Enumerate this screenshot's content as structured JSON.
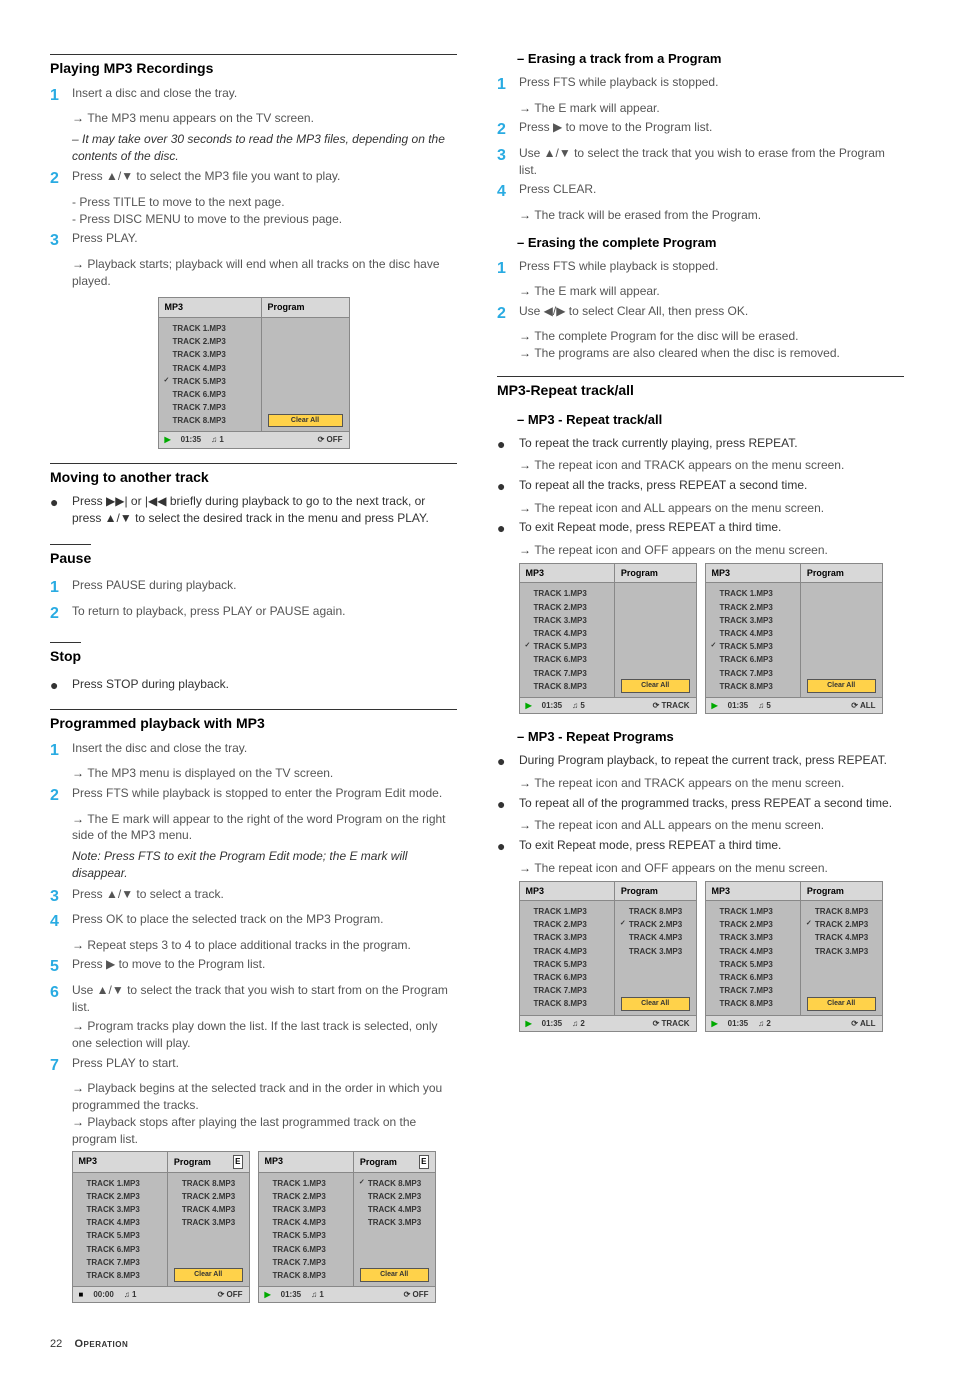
{
  "left": {
    "h_play": "Playing MP3 Recordings",
    "s1": "Insert a disc and close the tray.",
    "s1a": "The MP3 menu appears on the TV screen.",
    "s1note": "– It may take over 30 seconds to read the MP3 files, depending on the contents of the disc.",
    "s2": "Press ▲/▼ to select the MP3 file you want to play.",
    "s2a": "- Press TITLE to move to the next page.",
    "s2b": "- Press DISC MENU to move to the previous page.",
    "s3": "Press PLAY.",
    "s3a": "Playback starts; playback will end when all tracks on the disc have played.",
    "h_move": "Moving to another track",
    "move_b": "Press ▶▶| or |◀◀ briefly during playback to go to the next track, or press ▲/▼ to select the desired track in the menu and press PLAY.",
    "h_pause": "Pause",
    "p1": "Press PAUSE during playback.",
    "p2": "To return to playback, press PLAY or PAUSE again.",
    "h_stop": "Stop",
    "stop_b": "Press STOP during playback.",
    "h_prog": "Programmed playback with MP3",
    "pp1": "Insert the disc and close the tray.",
    "pp1a": "The MP3 menu is displayed on the TV screen.",
    "pp2": "Press FTS while playback is stopped to enter the Program Edit mode.",
    "pp2a": "The E mark will appear to the right of the word Program on the right side of the MP3 menu.",
    "pp2note": "Note: Press FTS to exit the Program Edit mode;  the E mark will disappear.",
    "pp3": "Press ▲/▼ to select a track.",
    "pp4": "Press OK to place the selected track on the MP3 Program.",
    "pp4a": "Repeat steps 3 to 4 to place additional tracks in the program.",
    "pp5": "Press ▶ to move to the Program list.",
    "pp6": "Use ▲/▼ to select the track that you wish to start from on the Program list.",
    "pp6a": "Program tracks play down the list. If the last track is selected, only one selection will play.",
    "pp7": "Press PLAY to start.",
    "pp7a": "Playback begins at the selected track and in the order in which you programmed the tracks.",
    "pp7b": "Playback stops after playing the last programmed track on the program list."
  },
  "right": {
    "h_erase": "– Erasing a track from a Program",
    "e1": "Press FTS while playback is stopped.",
    "e1a": "The E mark will appear.",
    "e2": "Press ▶ to move to the Program list.",
    "e3": "Use ▲/▼ to select the track that you wish to erase from the Program list.",
    "e4": "Press CLEAR.",
    "e4a": "The track will be erased from the Program.",
    "h_eraseall": "– Erasing the complete Program",
    "ea1": "Press FTS while playback is stopped.",
    "ea1a": "The E mark will appear.",
    "ea2": "Use ◀/▶ to select Clear All, then press OK.",
    "ea2a": "The complete Program for the disc will be erased.",
    "ea2b": "The programs are also cleared when the disc is removed.",
    "h_repeat": "MP3-Repeat track/all",
    "h_rta": "– MP3 - Repeat track/all",
    "r1": "To repeat the track currently playing, press REPEAT.",
    "r1a": "The repeat icon and TRACK appears on the menu screen.",
    "r2": "To repeat all the tracks, press REPEAT a second time.",
    "r2a": "The repeat icon and ALL appears on the menu screen.",
    "r3": "To exit Repeat mode, press REPEAT a third time.",
    "r3a": "The repeat icon and OFF appears on the menu screen.",
    "h_rprog": "– MP3 - Repeat Programs",
    "rp1": "During Program playback, to repeat the current track, press REPEAT.",
    "rp1a": "The repeat icon and TRACK appears on the menu screen.",
    "rp2": "To repeat all of the programmed tracks, press REPEAT a second time.",
    "rp2a": "The repeat icon and ALL appears on the menu screen.",
    "rp3": "To exit Repeat mode, press REPEAT a third time.",
    "rp3a": "The repeat icon and OFF appears on the menu screen."
  },
  "panel": {
    "title_mp3": "MP3",
    "title_prog": "Program",
    "tracks": [
      "TRACK 1.MP3",
      "TRACK 2.MP3",
      "TRACK 3.MP3",
      "TRACK 4.MP3",
      "TRACK 5.MP3",
      "TRACK 6.MP3",
      "TRACK 7.MP3",
      "TRACK 8.MP3"
    ],
    "prog4": [
      "TRACK 8.MP3",
      "TRACK 2.MP3",
      "TRACK 4.MP3",
      "TRACK 3.MP3"
    ],
    "clear": "Clear All",
    "t0135": "01:35",
    "t0000": "00:00",
    "tn1": "1",
    "tn2": "2",
    "tn5": "5",
    "off": "OFF",
    "track_lbl": "TRACK",
    "all_lbl": "ALL",
    "E": "E"
  },
  "footer": {
    "page": "22",
    "section": "Operation"
  }
}
